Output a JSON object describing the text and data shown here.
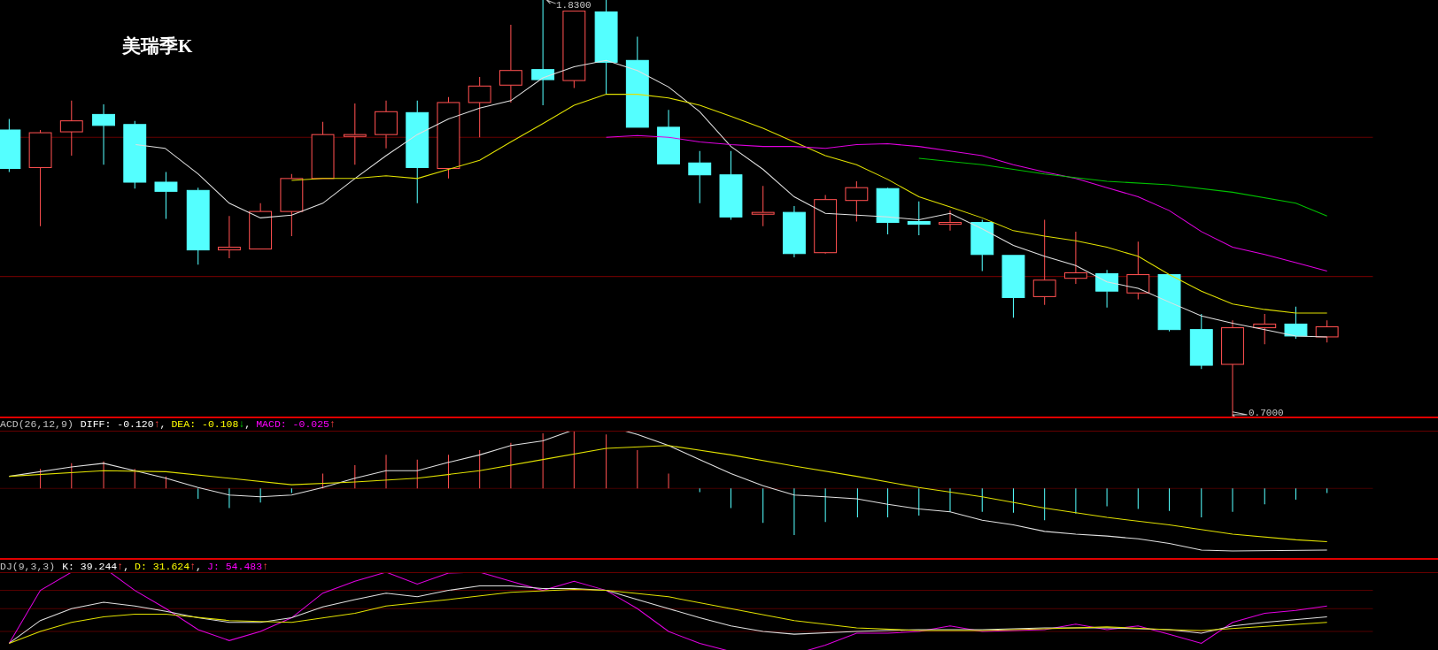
{
  "chart_title": "美瑞季K",
  "price_chart": {
    "high_label": "1.8300",
    "low_label": "0.7000"
  },
  "macd": {
    "name": "ACD(26,12,9)",
    "items": [
      {
        "label": "DIFF: -0.120",
        "arrow": "↑",
        "rising": true,
        "color": "#ffffff",
        "suffix": ","
      },
      {
        "label": "DEA: -0.108",
        "arrow": "↓",
        "rising": false,
        "color": "#ffff00",
        "suffix": ","
      },
      {
        "label": "MACD: -0.025",
        "arrow": "↑",
        "rising": true,
        "color": "#ff00ff"
      }
    ]
  },
  "kdj": {
    "name": "DJ(9,3,3)",
    "items": [
      {
        "label": "K: 39.244",
        "arrow": "↑",
        "rising": true,
        "color": "#ffffff",
        "suffix": ","
      },
      {
        "label": "D: 31.624",
        "arrow": "↑",
        "rising": true,
        "color": "#ffff00",
        "suffix": ","
      },
      {
        "label": "J: 54.483",
        "arrow": "↑",
        "rising": true,
        "color": "#ff00ff"
      }
    ]
  }
}
